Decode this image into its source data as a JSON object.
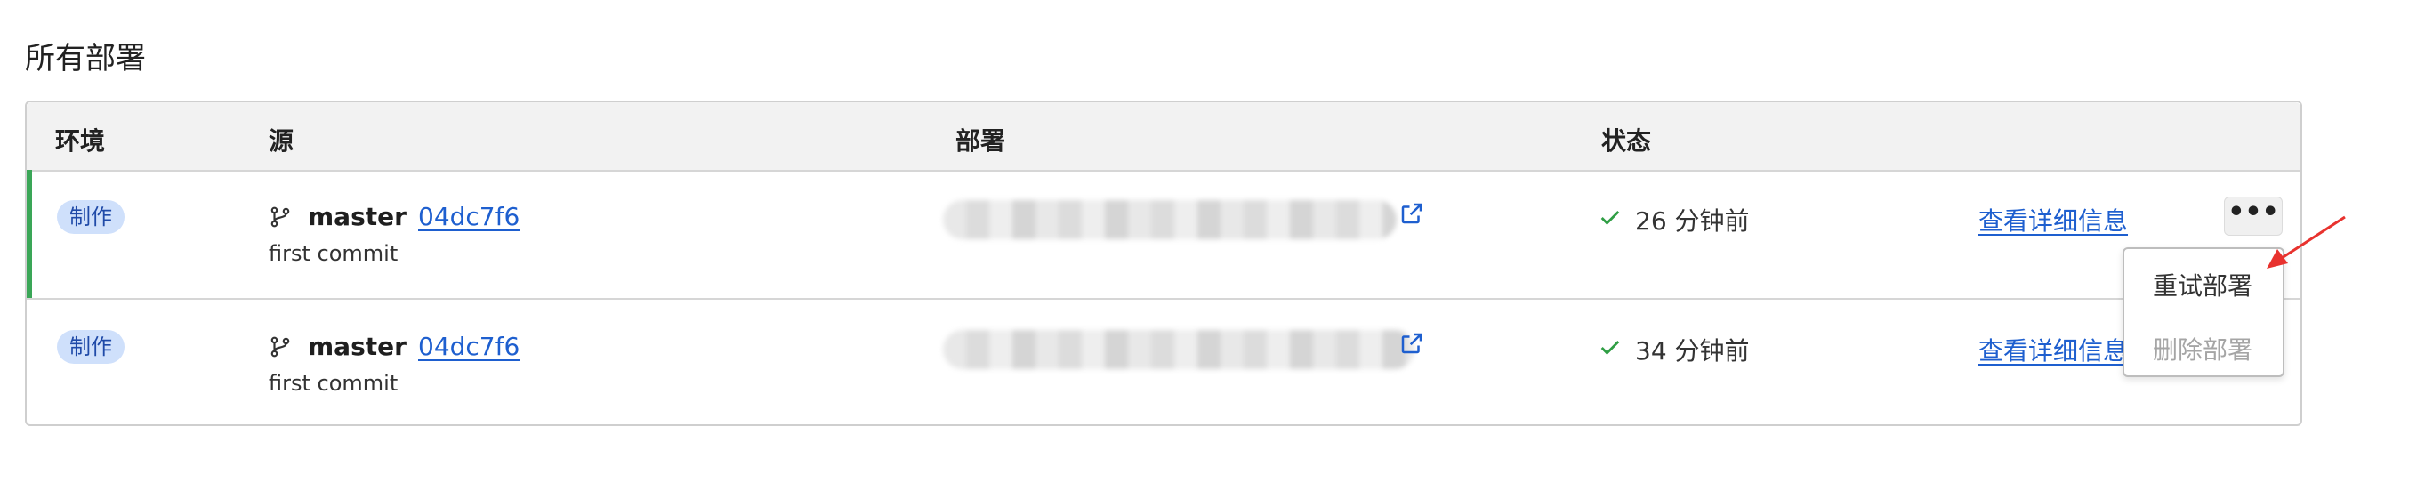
{
  "section_title": "所有部署",
  "table": {
    "headers": {
      "env": "环境",
      "source": "源",
      "deployment": "部署",
      "status": "状态"
    },
    "rows": [
      {
        "env": "制作",
        "branch": "master",
        "commit": "04dc7f6",
        "message": "first commit",
        "time": "26 分钟前",
        "details": "查看详细信息"
      },
      {
        "env": "制作",
        "branch": "master",
        "commit": "04dc7f6",
        "message": "first commit",
        "time": "34 分钟前",
        "details": "查看详细信息"
      }
    ]
  },
  "more_button_label": "•••",
  "menu": {
    "items": [
      {
        "label": "重试部署",
        "enabled": true
      },
      {
        "label": "删除部署",
        "enabled": false
      }
    ]
  },
  "colors": {
    "accent_success": "#3aa657",
    "link": "#1e5fcf",
    "badge_bg": "#cfe0fb",
    "annotation": "#e8322e"
  },
  "icons": {
    "branch": "git-branch-icon",
    "external": "external-link-icon",
    "status": "check-icon",
    "menu": "more-dots-icon"
  }
}
